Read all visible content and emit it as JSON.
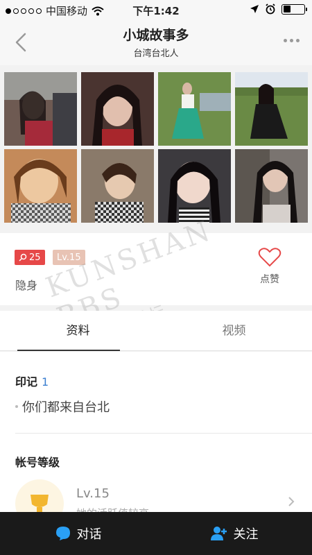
{
  "status_bar": {
    "carrier": "中国移动",
    "time": "下午1:42",
    "signal_bars_filled": 1,
    "signal_bars_total": 5,
    "battery_level": 0.35
  },
  "nav": {
    "title": "小城故事多",
    "subtitle": "台湾台北人",
    "back_icon": "chevron-left-icon",
    "more_icon": "ellipsis-icon"
  },
  "photos": {
    "count": 8,
    "colors": [
      "#6e5a52",
      "#4a3430",
      "#6f8f4a",
      "#6a8a45",
      "#c48a5a",
      "#8a7a6a",
      "#3c3a3e",
      "#7a7470"
    ]
  },
  "profile": {
    "likes_count": "25",
    "level_badge": "Lv.15",
    "status": "隐身",
    "like_label": "点赞",
    "accent_color": "#e64848"
  },
  "tabs": [
    {
      "label": "资料",
      "active": true
    },
    {
      "label": "视频",
      "active": false
    }
  ],
  "impressions": {
    "title": "印记",
    "count": "1",
    "items": [
      "你们都来自台北"
    ]
  },
  "account_level": {
    "title": "帐号等级",
    "level": "Lv.15",
    "description": "她的活跃值较高"
  },
  "watermark": {
    "text": "KUNSHAN BBS",
    "text_cn": "昆山论坛"
  },
  "bottom_bar": {
    "chat_label": "对话",
    "follow_label": "关注",
    "chat_icon_color": "#2aa0f5",
    "follow_icon_color": "#2aa0f5"
  }
}
